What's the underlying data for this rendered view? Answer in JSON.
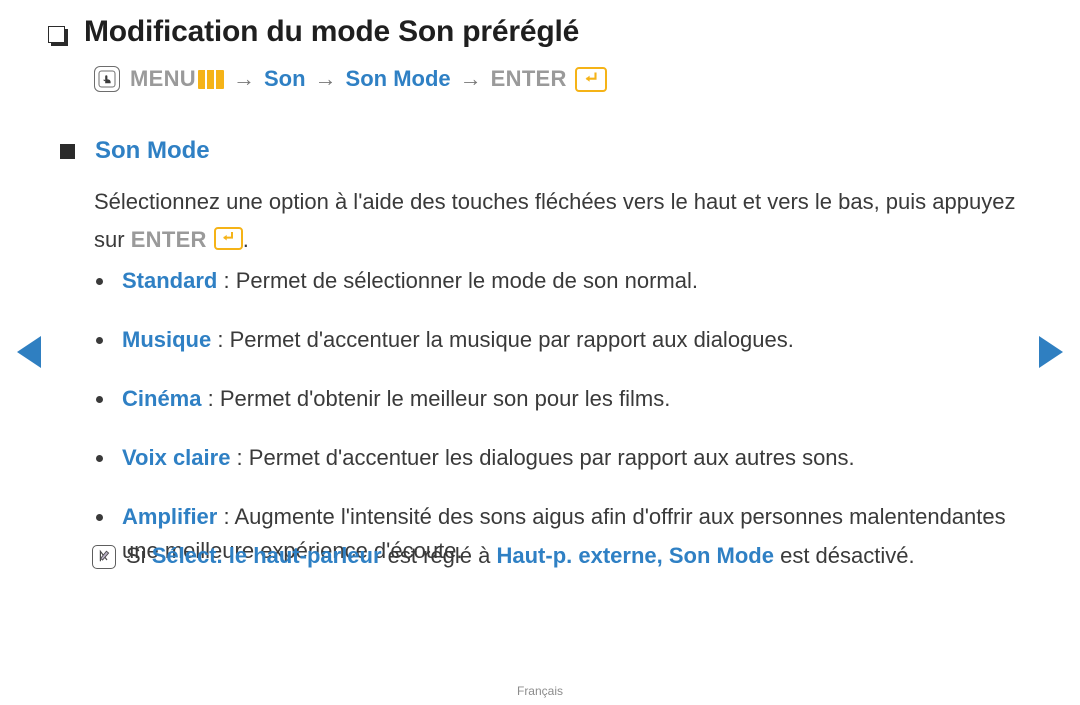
{
  "page": {
    "title": "Modification du mode Son préréglé",
    "footer_language": "Français",
    "accent_blue": "#2f80c4",
    "accent_orange": "#f5b317",
    "text_gray": "#9a9a9a",
    "body_color": "#3a3a3a",
    "background": "#ffffff"
  },
  "menu_path": {
    "hand_icon": "hand-press-icon",
    "menu_label": "MENU",
    "menu_bars_icon": "menu-bars-icon",
    "arrow": "→",
    "step_son": "Son",
    "step_son_mode": "Son Mode",
    "enter_label": "ENTER",
    "enter_icon": "enter-key-icon"
  },
  "section": {
    "heading": "Son Mode",
    "intro_before_enter": "Sélectionnez une option à l'aide des touches fléchées vers le haut et vers le bas, puis appuyez sur ",
    "intro_enter_word": "ENTER",
    "intro_after_enter": "."
  },
  "options": [
    {
      "term": "Standard",
      "separator": " : ",
      "description": "Permet de sélectionner le mode de son normal."
    },
    {
      "term": "Musique",
      "separator": " : ",
      "description": "Permet d'accentuer la musique par rapport aux dialogues."
    },
    {
      "term": "Cinéma",
      "separator": " : ",
      "description": "Permet d'obtenir le meilleur son pour les films."
    },
    {
      "term": "Voix claire",
      "separator": " : ",
      "description": "Permet d'accentuer les dialogues par rapport aux autres sons."
    },
    {
      "term": "Amplifier",
      "separator": " : ",
      "description": "Augmente l'intensité des sons aigus afin d'offrir aux personnes malentendantes une meilleure expérience d'écoute."
    }
  ],
  "note": {
    "icon": "note-pen-icon",
    "part1": "Si ",
    "highlight1": "Sélect. le haut-parleur",
    "part2": " est réglé à ",
    "highlight2": "Haut-p. externe, Son Mode",
    "part3": " est désactivé."
  },
  "navigation": {
    "prev_icon": "previous-page-arrow",
    "next_icon": "next-page-arrow"
  }
}
